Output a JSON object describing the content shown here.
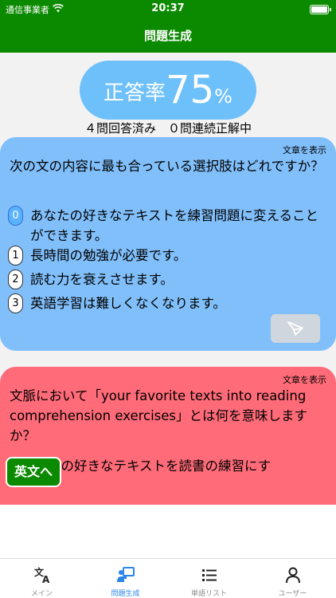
{
  "status_bar": {
    "carrier": "通信事業者",
    "time": "20:37"
  },
  "nav": {
    "title": "問題生成"
  },
  "score": {
    "label": "正答率",
    "value": "75",
    "unit": "%"
  },
  "stats": {
    "text": "４問回答済み　０問連続正解中"
  },
  "card_blue": {
    "show_text": "文章を表示",
    "question": "次の文の内容に最も合っている選択肢はどれですか？",
    "options": [
      {
        "num": "0",
        "text": "あなたの好きなテキストを練習問題に変えることができます。",
        "selected": true
      },
      {
        "num": "1",
        "text": "長時間の勉強が必要です。",
        "selected": false
      },
      {
        "num": "2",
        "text": "読む力を衰えさせます。",
        "selected": false
      },
      {
        "num": "3",
        "text": "英語学習は難しくなくなります。",
        "selected": false
      }
    ],
    "send_icon": "paper-plane-icon"
  },
  "card_red": {
    "show_text": "文章を表示",
    "question": "文脈において「your favorite texts into reading comprehension exercises」とは何を意味しますか？",
    "partial_text": "たの好きなテキストを読書の練習にす"
  },
  "english_button": {
    "label": "英文へ"
  },
  "tabbar": {
    "tabs": [
      {
        "label": "メイン",
        "icon": "translate-icon",
        "active": false
      },
      {
        "label": "問題生成",
        "icon": "presenter-icon",
        "active": true
      },
      {
        "label": "単語リスト",
        "icon": "list-icon",
        "active": false
      },
      {
        "label": "ユーザー",
        "icon": "person-icon",
        "active": false
      }
    ]
  },
  "colors": {
    "header": "#0b8a00",
    "score_pill": "#6ec0fa",
    "card_blue": "#81bffb",
    "card_red": "#ff6b78",
    "tab_active": "#2b86e8",
    "tab_inactive": "#8e8e8e"
  }
}
